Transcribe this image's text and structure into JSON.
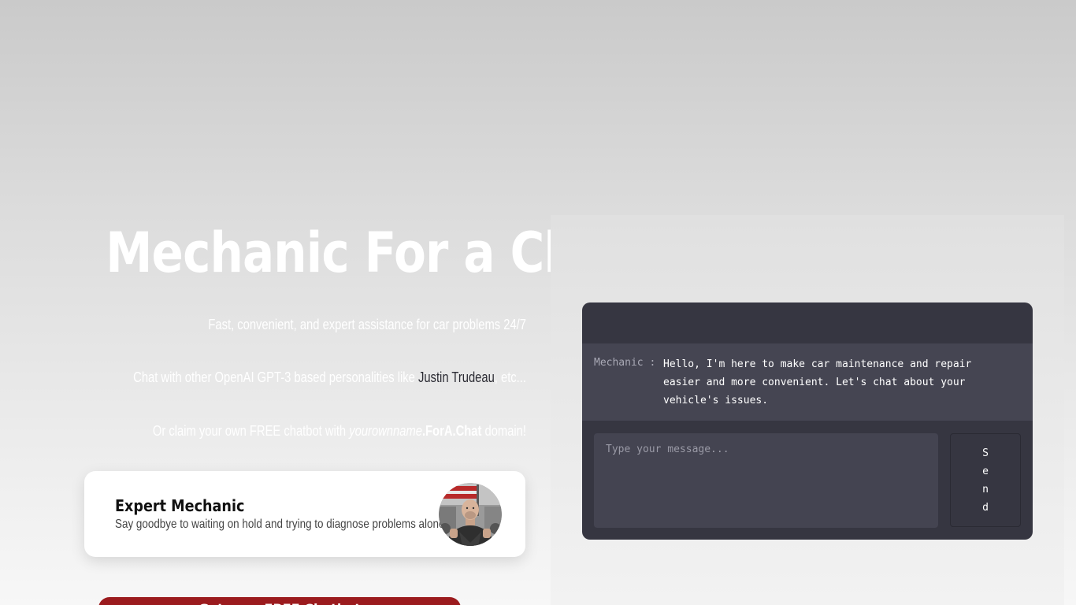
{
  "hero": {
    "title": "Mechanic For a Chat",
    "tagline": "Fast, convenient, and expert assistance for car problems 24/7",
    "personalities_prefix": "Chat with other OpenAI GPT-3 based personalities like ",
    "personalities_link": "Justin Trudeau",
    "personalities_suffix": ", etc...",
    "claim_prefix": "Or claim your own FREE chatbot with ",
    "claim_domain_name": "yourownname",
    "claim_domain_suffix": ".ForA.Chat",
    "claim_suffix": " domain!"
  },
  "bot_card": {
    "title": "Expert Mechanic",
    "description": "Say goodbye to waiting on hold and trying to diagnose problems alone",
    "avatar_icon": "mechanic-portrait"
  },
  "cta": {
    "label": "Get your FREE Chatbot"
  },
  "chat": {
    "messages": [
      {
        "sender": "Mechanic :",
        "text": "Hello, I'm here to make car maintenance and repair easier and more convenient. Let's chat about your vehicle's issues."
      }
    ],
    "input_placeholder": "Type your message...",
    "send_label": "Send"
  },
  "colors": {
    "accent": "#9b1b1e",
    "chat_background": "#363641",
    "message_background": "#454552"
  }
}
